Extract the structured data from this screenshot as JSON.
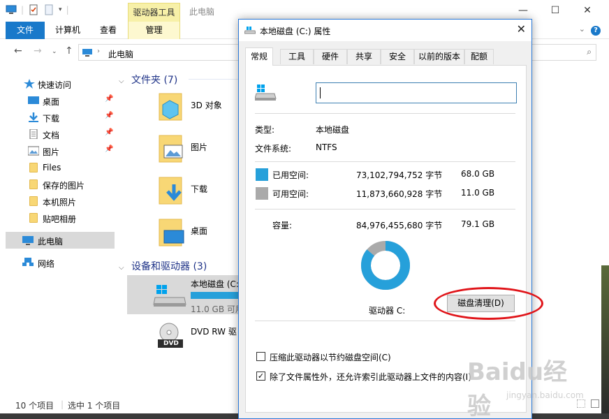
{
  "explorer": {
    "title": "此电脑",
    "context_tab": "驱动器工具",
    "ribbon_tabs": [
      "文件",
      "计算机",
      "查看",
      "管理"
    ],
    "address_path": "此电脑",
    "nav": {
      "quick_access": "快速访问",
      "quick_items": [
        "桌面",
        "下载",
        "文档",
        "图片"
      ],
      "folders": [
        "Files",
        "保存的图片",
        "本机照片",
        "贴吧相册"
      ],
      "this_pc": "此电脑",
      "network": "网络"
    },
    "folders_group": "文件夹 (7)",
    "folder_tiles": [
      "3D 对象",
      "图片",
      "下载",
      "桌面"
    ],
    "devices_group": "设备和驱动器 (3)",
    "drive_c_name": "本地磁盘 (C:",
    "drive_c_free": "11.0 GB 可用",
    "drive_c_used_fraction": 0.861,
    "dvd_name": "DVD RW 驱",
    "dvd_label": "DVD",
    "status_items": "10 个项目",
    "status_selected": "选中 1 个项目"
  },
  "dialog": {
    "title": "本地磁盘 (C:) 属性",
    "tabs": [
      "常规",
      "工具",
      "硬件",
      "共享",
      "安全",
      "以前的版本",
      "配额"
    ],
    "active_tab": "常规",
    "name_value": "",
    "type_label": "类型:",
    "type_value": "本地磁盘",
    "fs_label": "文件系统:",
    "fs_value": "NTFS",
    "used_label": "已用空间:",
    "used_bytes": "73,102,794,752 字节",
    "used_gb": "68.0 GB",
    "free_label": "可用空间:",
    "free_bytes": "11,873,660,928 字节",
    "free_gb": "11.0 GB",
    "cap_label": "容量:",
    "cap_bytes": "84,976,455,680 字节",
    "cap_gb": "79.1 GB",
    "used_fraction": 0.861,
    "drive_label": "驱动器 C:",
    "cleanup_button": "磁盘清理(D)",
    "compress_label": "压缩此驱动器以节约磁盘空间(C)",
    "compress_checked": false,
    "index_label": "除了文件属性外，还允许索引此驱动器上文件的内容(I)",
    "index_checked": true,
    "colors": {
      "used": "#26a0da",
      "free": "#aaaaaa"
    }
  },
  "watermark": {
    "brand": "Baidu经验",
    "url": "jingyan.baidu.com"
  }
}
